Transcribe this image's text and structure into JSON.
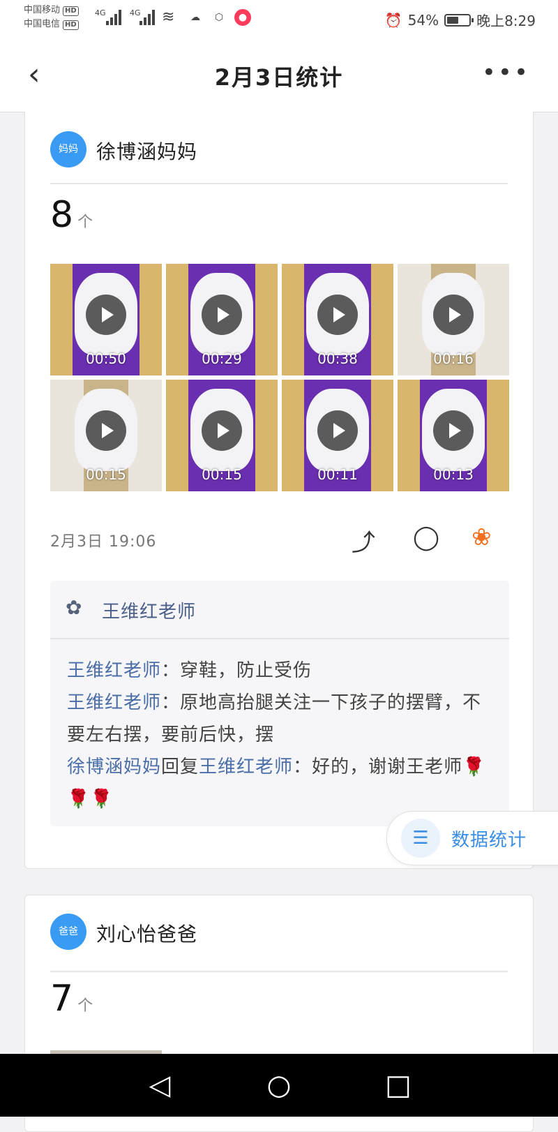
{
  "status_bar": {
    "carrier1": "中国移动",
    "carrier2": "中国电信",
    "hd": "HD",
    "net1": "4G",
    "net2": "4G",
    "battery_percent": "54%",
    "battery_level": 0.54,
    "time": "晚上8:29"
  },
  "header": {
    "title": "2月3日统计"
  },
  "entries": [
    {
      "avatar_label": "妈妈",
      "name": "徐博涵妈妈",
      "count": "8",
      "unit": "个",
      "videos": [
        {
          "duration": "00:50"
        },
        {
          "duration": "00:29"
        },
        {
          "duration": "00:38"
        },
        {
          "duration": "00:16"
        },
        {
          "duration": "00:15"
        },
        {
          "duration": "00:15"
        },
        {
          "duration": "00:11"
        },
        {
          "duration": "00:13"
        }
      ],
      "timestamp": "2月3日 19:06",
      "liked_by": "王维红老师",
      "comments": [
        {
          "author": "王维红老师",
          "sep": "：",
          "text": "穿鞋，防止受伤"
        },
        {
          "author": "王维红老师",
          "sep": "：",
          "text": "原地高抬腿关注一下孩子的摆臂，不要左右摆，要前后快，摆"
        },
        {
          "author": "徐博涵妈妈",
          "reply_word": "回复",
          "reply_to": "王维红老师",
          "sep": "：",
          "text": "好的，谢谢王老师🌹🌹🌹"
        }
      ]
    },
    {
      "avatar_label": "爸爸",
      "name": "刘心怡爸爸",
      "count": "7",
      "unit": "个"
    }
  ],
  "floating_button": {
    "label": "数据统计",
    "icon": "bar-chart-icon"
  },
  "colors": {
    "accent": "#3a9bf5",
    "flower": "#f4701f",
    "link": "#4a6ea8"
  }
}
